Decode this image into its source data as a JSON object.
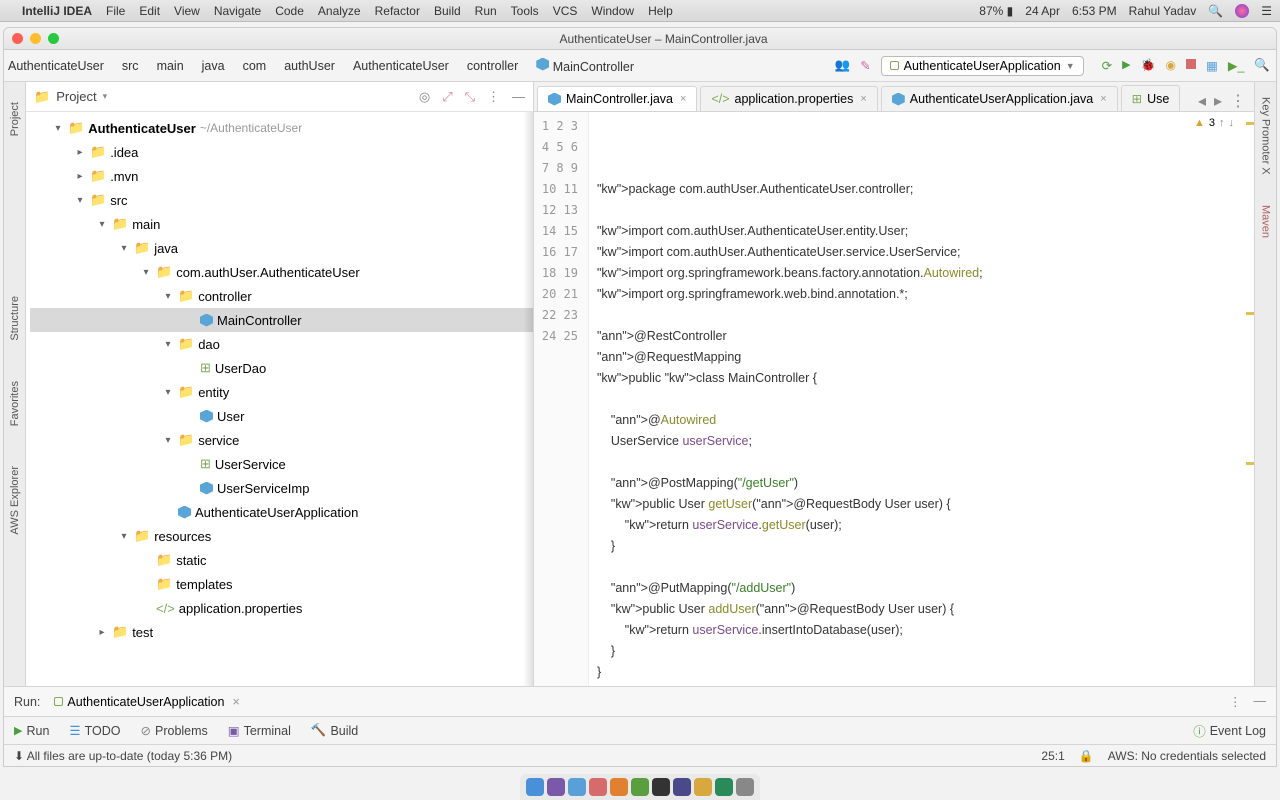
{
  "menubar": {
    "app": "IntelliJ IDEA",
    "items": [
      "File",
      "Edit",
      "View",
      "Navigate",
      "Code",
      "Analyze",
      "Refactor",
      "Build",
      "Run",
      "Tools",
      "VCS",
      "Window",
      "Help"
    ],
    "battery": "87%",
    "date": "24 Apr",
    "time": "6:53 PM",
    "user": "Rahul Yadav"
  },
  "window": {
    "title": "AuthenticateUser – MainController.java"
  },
  "breadcrumb": [
    "AuthenticateUser",
    "src",
    "main",
    "java",
    "com",
    "authUser",
    "AuthenticateUser",
    "controller",
    "MainController"
  ],
  "run_config": "AuthenticateUserApplication",
  "leftrail": [
    "Project",
    "Structure",
    "Favorites",
    "AWS Explorer"
  ],
  "rightrail": [
    "Key Promoter X",
    "Maven"
  ],
  "project_pane": {
    "title": "Project",
    "root": {
      "name": "AuthenticateUser",
      "path": "~/AuthenticateUser"
    },
    "tree": [
      {
        "d": 1,
        "chev": "down",
        "ico": "dir",
        "name": "AuthenticateUser",
        "suffix": "~/AuthenticateUser",
        "bold": true
      },
      {
        "d": 2,
        "chev": "right",
        "ico": "dir-b",
        "name": ".idea"
      },
      {
        "d": 2,
        "chev": "right",
        "ico": "dir-k",
        "name": ".mvn"
      },
      {
        "d": 2,
        "chev": "down",
        "ico": "dir-b",
        "name": "src"
      },
      {
        "d": 3,
        "chev": "down",
        "ico": "dir",
        "name": "main"
      },
      {
        "d": 4,
        "chev": "down",
        "ico": "dir-b",
        "name": "java"
      },
      {
        "d": 5,
        "chev": "down",
        "ico": "dir",
        "name": "com.authUser.AuthenticateUser"
      },
      {
        "d": 6,
        "chev": "down",
        "ico": "pkg",
        "name": "controller"
      },
      {
        "d": 7,
        "chev": "",
        "ico": "cls",
        "name": "MainController",
        "sel": true
      },
      {
        "d": 6,
        "chev": "down",
        "ico": "dir",
        "name": "dao"
      },
      {
        "d": 7,
        "chev": "",
        "ico": "if",
        "name": "UserDao"
      },
      {
        "d": 6,
        "chev": "down",
        "ico": "dir",
        "name": "entity"
      },
      {
        "d": 7,
        "chev": "",
        "ico": "cls",
        "name": "User"
      },
      {
        "d": 6,
        "chev": "down",
        "ico": "dir",
        "name": "service"
      },
      {
        "d": 7,
        "chev": "",
        "ico": "if",
        "name": "UserService"
      },
      {
        "d": 7,
        "chev": "",
        "ico": "cls",
        "name": "UserServiceImp"
      },
      {
        "d": 6,
        "chev": "",
        "ico": "cls",
        "name": "AuthenticateUserApplication"
      },
      {
        "d": 4,
        "chev": "down",
        "ico": "res",
        "name": "resources"
      },
      {
        "d": 5,
        "chev": "",
        "ico": "dir-b",
        "name": "static"
      },
      {
        "d": 5,
        "chev": "",
        "ico": "dir-y",
        "name": "templates"
      },
      {
        "d": 5,
        "chev": "",
        "ico": "prop",
        "name": "application.properties"
      },
      {
        "d": 3,
        "chev": "right",
        "ico": "dir-g",
        "name": "test"
      }
    ]
  },
  "tabs": [
    {
      "name": "MainController.java",
      "ico": "cls",
      "active": true
    },
    {
      "name": "application.properties",
      "ico": "prop"
    },
    {
      "name": "AuthenticateUserApplication.java",
      "ico": "cls"
    },
    {
      "name": "Use",
      "ico": "if",
      "cut": true
    }
  ],
  "code": {
    "inspection_count": "3",
    "lines": [
      "package com.authUser.AuthenticateUser.controller;",
      "",
      "import com.authUser.AuthenticateUser.entity.User;",
      "import com.authUser.AuthenticateUser.service.UserService;",
      "import org.springframework.beans.factory.annotation.Autowired;",
      "import org.springframework.web.bind.annotation.*;",
      "",
      "@RestController",
      "@RequestMapping",
      "public class MainController {",
      "",
      "    @Autowired",
      "    UserService userService;",
      "",
      "    @PostMapping(\"/getUser\")",
      "    public User getUser(@RequestBody User user) {",
      "        return userService.getUser(user);",
      "    }",
      "",
      "    @PutMapping(\"/addUser\")",
      "    public User addUser(@RequestBody User user) {",
      "        return userService.insertIntoDatabase(user);",
      "    }",
      "}",
      ""
    ]
  },
  "run_panel": {
    "label": "Run:",
    "config": "AuthenticateUserApplication"
  },
  "bottom_tabs": [
    "Run",
    "TODO",
    "Problems",
    "Terminal",
    "Build"
  ],
  "event_log": "Event Log",
  "status": {
    "vcs": "All files are up-to-date (today 5:36 PM)",
    "pos": "25:1",
    "aws": "AWS: No credentials selected"
  }
}
